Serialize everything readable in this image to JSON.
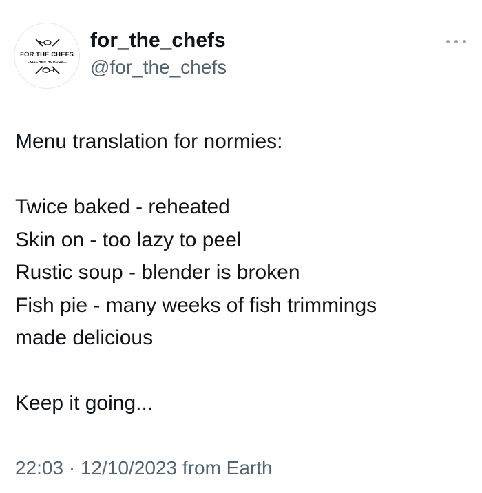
{
  "author": {
    "display_name": "for_the_chefs",
    "handle": "@for_the_chefs",
    "avatar_icon": "for-the-chefs-logo-icon",
    "avatar_text": "FOR THE CHEFS",
    "avatar_subtext": "KITCHEN HUMOUR"
  },
  "menu": {
    "more_icon": "more-options-icon"
  },
  "tweet": {
    "intro": "Menu translation for normies:",
    "lines": [
      "Twice baked - reheated",
      "Skin on - too lazy to peel",
      "Rustic soup - blender is broken",
      "Fish pie - many weeks of fish trimmings",
      "made delicious"
    ],
    "closing": "Keep it going..."
  },
  "meta": {
    "time": "22:03",
    "separator": "·",
    "date": "12/10/2023",
    "source": "from Earth"
  },
  "colors": {
    "text": "#0f1419",
    "secondary": "#536471",
    "background": "#ffffff"
  }
}
